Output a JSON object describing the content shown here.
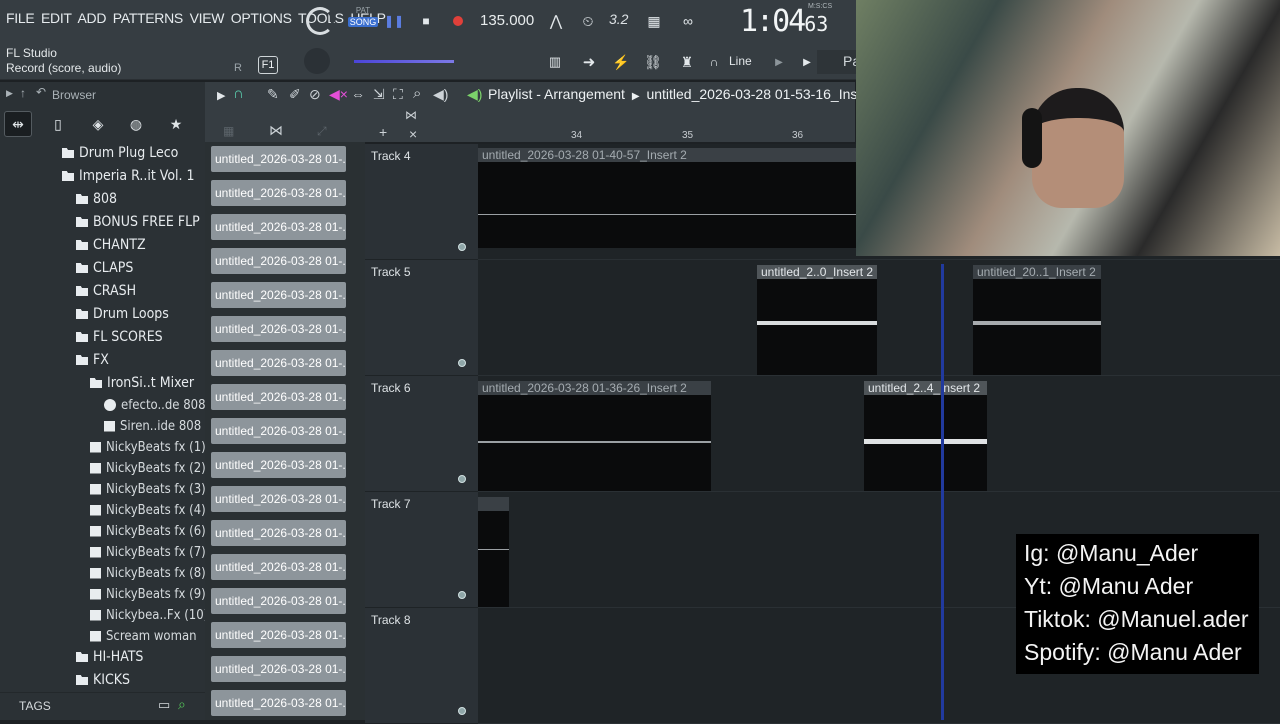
{
  "menu": [
    "FILE",
    "EDIT",
    "ADD",
    "PATTERNS",
    "VIEW",
    "OPTIONS",
    "TOOLS",
    "HELP"
  ],
  "transport": {
    "pat_label": "PAT",
    "song_label": "SONG",
    "tempo": "135.000",
    "time_main": "1:04",
    "time_sub": "63",
    "time_unit": "M:S:CS",
    "pattern_tag": "3.2"
  },
  "app": {
    "name": "FL Studio",
    "hint": "Record (score, audio)",
    "f1": "F1",
    "r_label": "R",
    "snap": "Line",
    "pa_label": "Pa"
  },
  "browser": {
    "title": "Browser",
    "tags": "TAGS",
    "items": [
      {
        "label": "Drum Plug Leco",
        "level": 1,
        "type": "folder"
      },
      {
        "label": "Imperia R..it Vol. 1",
        "level": 1,
        "type": "folder"
      },
      {
        "label": "808",
        "level": 2,
        "type": "folder"
      },
      {
        "label": "BONUS FREE FLP",
        "level": 2,
        "type": "folder"
      },
      {
        "label": "CHANTZ",
        "level": 2,
        "type": "folder"
      },
      {
        "label": "CLAPS",
        "level": 2,
        "type": "folder"
      },
      {
        "label": "CRASH",
        "level": 2,
        "type": "folder"
      },
      {
        "label": "Drum Loops",
        "level": 2,
        "type": "folder"
      },
      {
        "label": "FL SCORES",
        "level": 2,
        "type": "folder"
      },
      {
        "label": "FX",
        "level": 2,
        "type": "folder"
      },
      {
        "label": "IronSi..t Mixer",
        "level": 3,
        "type": "folder"
      },
      {
        "label": "efecto..de 808",
        "level": 4,
        "type": "plugin"
      },
      {
        "label": "Siren..ide 808",
        "level": 4,
        "type": "audio"
      },
      {
        "label": "NickyBeats fx (1)",
        "level": 3,
        "type": "audio"
      },
      {
        "label": "NickyBeats fx (2)",
        "level": 3,
        "type": "audio"
      },
      {
        "label": "NickyBeats fx (3)",
        "level": 3,
        "type": "audio"
      },
      {
        "label": "NickyBeats fx (4)",
        "level": 3,
        "type": "audio"
      },
      {
        "label": "NickyBeats fx (6)",
        "level": 3,
        "type": "audio"
      },
      {
        "label": "NickyBeats fx (7)",
        "level": 3,
        "type": "audio"
      },
      {
        "label": "NickyBeats fx (8)",
        "level": 3,
        "type": "audio"
      },
      {
        "label": "NickyBeats fx (9)",
        "level": 3,
        "type": "audio"
      },
      {
        "label": "Nickybea..Fx (10)",
        "level": 3,
        "type": "audio"
      },
      {
        "label": "Scream woman",
        "level": 3,
        "type": "audio"
      },
      {
        "label": "HI-HATS",
        "level": 2,
        "type": "folder"
      },
      {
        "label": "KICKS",
        "level": 2,
        "type": "folder"
      }
    ]
  },
  "patterns": [
    "untitled_2026-03-28 01-...",
    "untitled_2026-03-28 01-...",
    "untitled_2026-03-28 01-...",
    "untitled_2026-03-28 01-...",
    "untitled_2026-03-28 01-...",
    "untitled_2026-03-28 01-...",
    "untitled_2026-03-28 01-...",
    "untitled_2026-03-28 01-...",
    "untitled_2026-03-28 01-...",
    "untitled_2026-03-28 01-...",
    "untitled_2026-03-28 01-...",
    "untitled_2026-03-28 01-...",
    "untitled_2026-03-28 01-...",
    "untitled_2026-03-28 01-...",
    "untitled_2026-03-28 01-...",
    "untitled_2026-03-28 01-...",
    "untitled_2026-03-28 01-..."
  ],
  "playlist": {
    "title": "Playlist - Arrangement",
    "file": "untitled_2026-03-28 01-53-16_Inse",
    "ruler": [
      "34",
      "35",
      "36"
    ],
    "tracks": [
      "Track 4",
      "Track 5",
      "Track 6",
      "Track 7",
      "Track 8"
    ],
    "clips": {
      "c4a": "untitled_2026-03-28 01-40-57_Insert 2",
      "c5a": "untitled_2..0_Insert 2",
      "c5b": "untitled_20..1_Insert 2",
      "c6a": "untitled_2026-03-28 01-36-26_Insert 2",
      "c6b": "untitled_2..4_Insert 2"
    }
  },
  "social": {
    "ig": "Ig: @Manu_Ader",
    "yt": "Yt: @Manu Ader",
    "tiktok": "Tiktok: @Manuel.ader",
    "spotify": "Spotify: @Manu Ader"
  }
}
